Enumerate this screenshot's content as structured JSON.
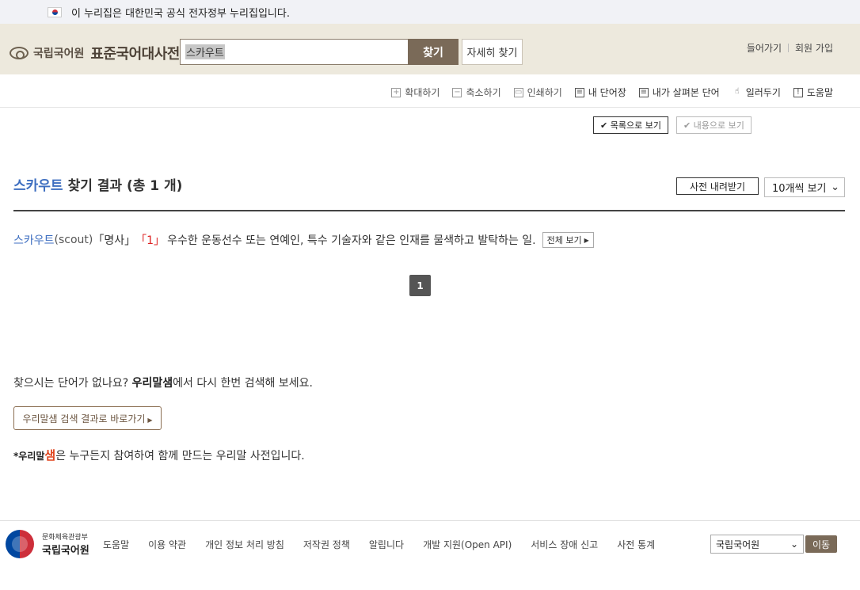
{
  "gov_banner": {
    "text": "이 누리집은 대한민국 공식 전자정부 누리집입니다."
  },
  "header": {
    "logo_org": "국립국어원",
    "logo_title": "표준국어대사전",
    "search_value": "스카우트",
    "search_button": "찾기",
    "advanced_button": "자세히 찾기",
    "login": "들어가기",
    "signup": "회원 가입"
  },
  "toolbar": {
    "zoom_in": "확대하기",
    "zoom_out": "축소하기",
    "print": "인쇄하기",
    "my_words": "내 단어장",
    "viewed_words": "내가 살펴본 단어",
    "notify": "일러두기",
    "help": "도움말"
  },
  "view": {
    "list": "목록으로 보기",
    "content": "내용으로 보기"
  },
  "results": {
    "keyword": "스카우트",
    "title_suffix": "찾기 결과 (총 1 개)",
    "download": "사전 내려받기",
    "per_page": "10개씩 보기",
    "items": [
      {
        "word": "스카우트",
        "origin": "(scout)",
        "pos": "「명사」",
        "sense_num": "「1」",
        "definition": "우수한 운동선수 또는 연예인, 특수 기술자와 같은 인재를 물색하고 발탁하는 일.",
        "more": "전체 보기"
      }
    ],
    "page": "1"
  },
  "suggest": {
    "prefix": "찾으시는 단어가 없나요?",
    "brand": "우리말샘",
    "suffix": "에서 다시 한번 검색해 보세요.",
    "button": "우리말샘 검색 결과로 바로가기"
  },
  "note": {
    "star": "*",
    "brand_a": "우리말",
    "brand_b": "샘",
    "text": "은 누구든지 참여하여 함께 만드는 우리말 사전입니다."
  },
  "footer": {
    "ministry": "문화체육관광부",
    "org": "국립국어원",
    "links": [
      "도움말",
      "이용 약관",
      "개인 정보 처리 방침",
      "저작권 정책",
      "알립니다",
      "개발 지원(Open API)",
      "서비스 장애 신고",
      "사전 통계"
    ],
    "select_value": "국립국어원",
    "go": "이동"
  },
  "colors": {
    "accent_brown": "#7a6a58",
    "keyword_blue": "#3d6ec0",
    "sense_red": "#dd2222"
  }
}
